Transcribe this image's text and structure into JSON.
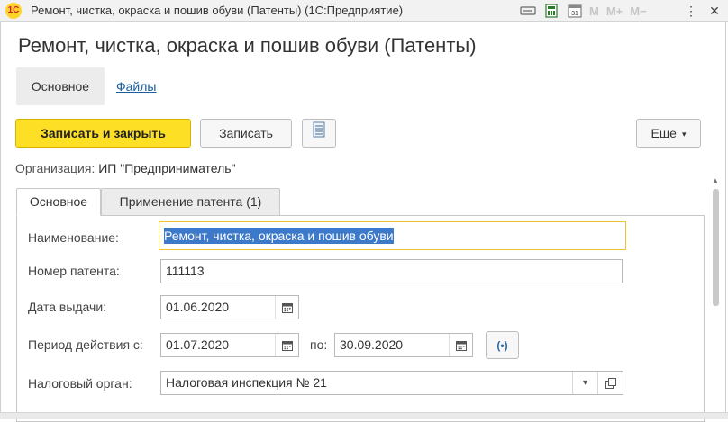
{
  "window": {
    "logo_text": "1С",
    "title": "Ремонт, чистка, окраска и пошив обуви (Патенты)  (1С:Предприятие)",
    "m_label": "M",
    "m_plus_label": "M+",
    "m_minus_label": "M−",
    "menu_glyph": "⋮",
    "close_glyph": "✕"
  },
  "form": {
    "title": "Ремонт, чистка, окраска и пошив обуви (Патенты)",
    "sections": {
      "main": "Основное",
      "files": "Файлы"
    },
    "toolbar": {
      "save_close": "Записать и закрыть",
      "save": "Записать",
      "more": "Еще",
      "more_caret": "▾"
    },
    "organization": {
      "label": "Организация:",
      "value": "ИП \"Предприниматель\""
    },
    "tabs": {
      "main": "Основное",
      "usage": "Применение патента (1)"
    },
    "fields": {
      "name_label": "Наименование:",
      "name_value": "Ремонт, чистка, окраска и пошив обуви",
      "patent_no_label": "Номер патента:",
      "patent_no_value": "111113",
      "issue_date_label": "Дата выдачи:",
      "issue_date_value": "01.06.2020",
      "period_label": "Период действия с:",
      "period_from": "01.07.2020",
      "period_to_label": "по:",
      "period_to": "30.09.2020",
      "period_btn_glyph": "(•)",
      "tax_office_label": "Налоговый орган:",
      "tax_office_value": "Налоговая инспекция № 21",
      "combo_caret": "▾"
    }
  },
  "colors": {
    "accent_primary": "#fde026",
    "link": "#1a5ea0",
    "selection": "#3c79c8",
    "focus_border": "#f0c230"
  },
  "icons": {
    "logo": "app-logo-icon",
    "calendar": "calendar-icon",
    "list": "list-icon",
    "open": "open-icon"
  }
}
